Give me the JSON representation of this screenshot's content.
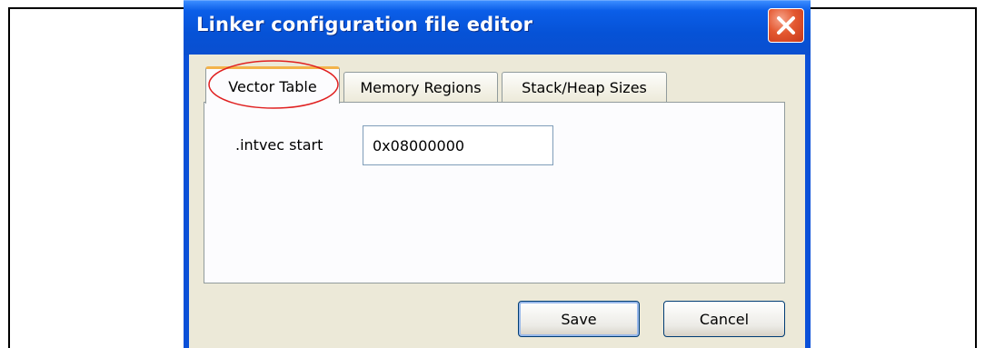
{
  "window": {
    "title": "Linker configuration file editor",
    "close_icon": "close-icon"
  },
  "tabs": [
    {
      "label": "Vector Table",
      "active": true
    },
    {
      "label": "Memory Regions",
      "active": false
    },
    {
      "label": "Stack/Heap Sizes",
      "active": false
    }
  ],
  "vector_table": {
    "intvec_label": ".intvec start",
    "intvec_value": "0x08000000"
  },
  "buttons": {
    "save_label": "Save",
    "cancel_label": "Cancel"
  },
  "annotation": {
    "highlight_color": "#e02020"
  },
  "colors": {
    "titlebar": "#0652d6",
    "client": "#ece9d8",
    "active_tab_accent": "#f3b34a"
  }
}
